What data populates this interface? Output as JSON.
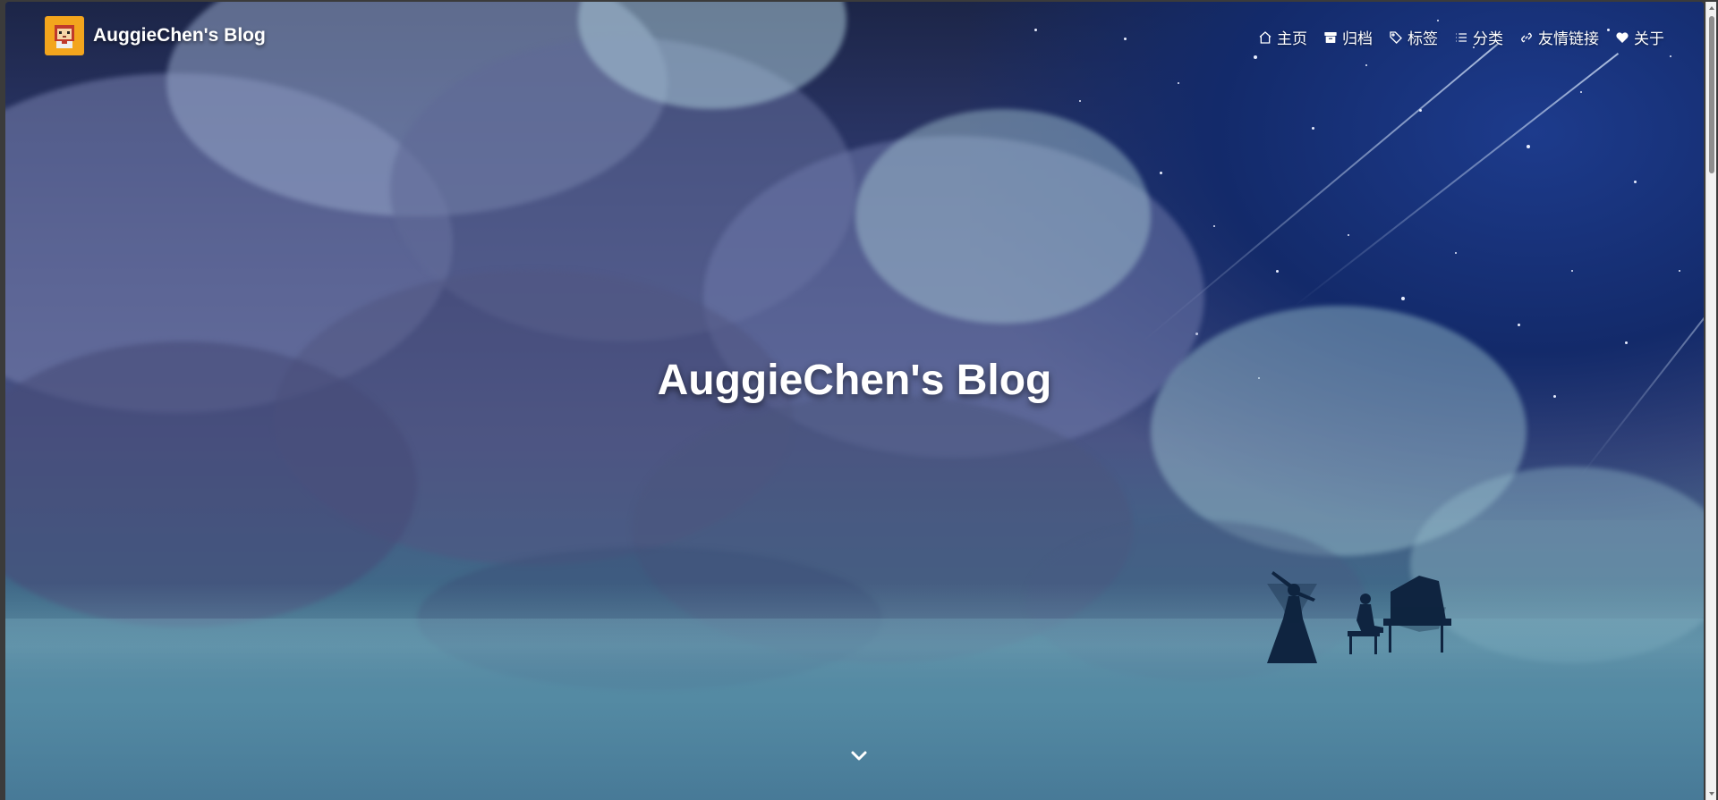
{
  "site": {
    "brand_name": "AuggieChen's Blog",
    "hero_title": "AuggieChen's Blog"
  },
  "nav": {
    "items": [
      {
        "label": "主页",
        "icon": "home-icon"
      },
      {
        "label": "归档",
        "icon": "archive-icon"
      },
      {
        "label": "标签",
        "icon": "tag-icon"
      },
      {
        "label": "分类",
        "icon": "list-icon"
      },
      {
        "label": "友情链接",
        "icon": "link-icon"
      },
      {
        "label": "关于",
        "icon": "heart-icon"
      }
    ]
  },
  "scroll_down": {
    "icon": "chevron-down-icon"
  },
  "colors": {
    "brand_logo_bg": "#f3a51d",
    "text": "#ffffff",
    "sky_deep": "#132a6a"
  }
}
